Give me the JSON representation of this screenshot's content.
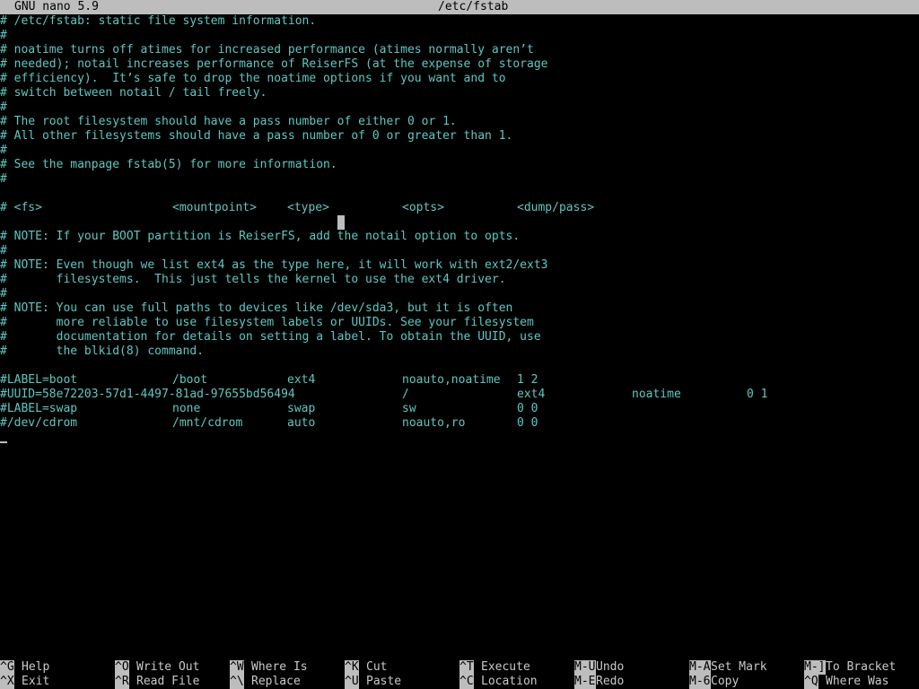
{
  "colors": {
    "background": "#000000",
    "text": "#5fc7c2",
    "titlebar_bg": "#bdbdbd",
    "titlebar_text": "#000000",
    "key_bg": "#bdbdbd",
    "key_text": "#000000",
    "label_text": "#c9c9c9",
    "cursor": "#bdbdbd"
  },
  "titlebar": {
    "app": "GNU nano 5.9",
    "filename": "/etc/fstab"
  },
  "file_lines": [
    [
      "# /etc/fstab: static file system information."
    ],
    [
      "#"
    ],
    [
      "# noatime turns off atimes for increased performance (atimes normally aren’t"
    ],
    [
      "# needed); notail increases performance of ReiserFS (at the expense of storage"
    ],
    [
      "# efficiency).  It’s safe to drop the noatime options if you want and to"
    ],
    [
      "# switch between notail / tail freely."
    ],
    [
      "#"
    ],
    [
      "# The root filesystem should have a pass number of either 0 or 1."
    ],
    [
      "# All other filesystems should have a pass number of 0 or greater than 1."
    ],
    [
      "#"
    ],
    [
      "# See the manpage fstab(5) for more information."
    ],
    [
      "#"
    ],
    [
      ""
    ],
    [
      "# <fs>",
      "<mountpoint>",
      "<type>",
      "<opts>",
      "<dump/pass>"
    ],
    [
      ""
    ],
    [
      "# NOTE: If your BOOT partition is ReiserFS, add the notail option to opts."
    ],
    [
      "#"
    ],
    [
      "# NOTE: Even though we list ext4 as the type here, it will work with ext2/ext3"
    ],
    [
      "#       filesystems.  This just tells the kernel to use the ext4 driver."
    ],
    [
      "#"
    ],
    [
      "# NOTE: You can use full paths to devices like /dev/sda3, but it is often"
    ],
    [
      "#       more reliable to use filesystem labels or UUIDs. See your filesystem"
    ],
    [
      "#       documentation for details on setting a label. To obtain the UUID, use"
    ],
    [
      "#       the blkid(8) command."
    ],
    [
      ""
    ],
    [
      "#LABEL=boot",
      "/boot",
      "ext4",
      "noauto,noatime",
      "1 2"
    ],
    [
      "#UUID=58e72203-57d1-4497-81ad-97655bd56494",
      "/",
      "ext4",
      "noatime",
      "0 1"
    ],
    [
      "#LABEL=swap",
      "none",
      "swap",
      "sw",
      "0 0"
    ],
    [
      "#/dev/cdrom",
      "/mnt/cdrom",
      "auto",
      "noauto,ro",
      "0 0"
    ]
  ],
  "shortcuts": [
    {
      "key": "^G",
      "label": "Help",
      "icon": "help-icon"
    },
    {
      "key": "^X",
      "label": "Exit",
      "icon": "exit-icon"
    },
    {
      "key": "^O",
      "label": "Write Out",
      "icon": "write-out-icon"
    },
    {
      "key": "^R",
      "label": "Read File",
      "icon": "read-file-icon"
    },
    {
      "key": "^W",
      "label": "Where Is",
      "icon": "where-is-icon"
    },
    {
      "key": "^\\",
      "label": "Replace",
      "icon": "replace-icon"
    },
    {
      "key": "^K",
      "label": "Cut",
      "icon": "cut-icon"
    },
    {
      "key": "^U",
      "label": "Paste",
      "icon": "paste-icon"
    },
    {
      "key": "^T",
      "label": "Execute",
      "icon": "execute-icon"
    },
    {
      "key": "^C",
      "label": "Location",
      "icon": "location-icon"
    },
    {
      "key": "M-U",
      "label": "Undo",
      "icon": "undo-icon"
    },
    {
      "key": "M-E",
      "label": "Redo",
      "icon": "redo-icon"
    },
    {
      "key": "M-A",
      "label": "Set Mark",
      "icon": "set-mark-icon"
    },
    {
      "key": "M-6",
      "label": "Copy",
      "icon": "copy-icon"
    },
    {
      "key": "M-]",
      "label": "To Bracket",
      "icon": "to-bracket-icon"
    },
    {
      "key": "^Q",
      "label": "Where Was",
      "icon": "where-was-icon"
    }
  ]
}
